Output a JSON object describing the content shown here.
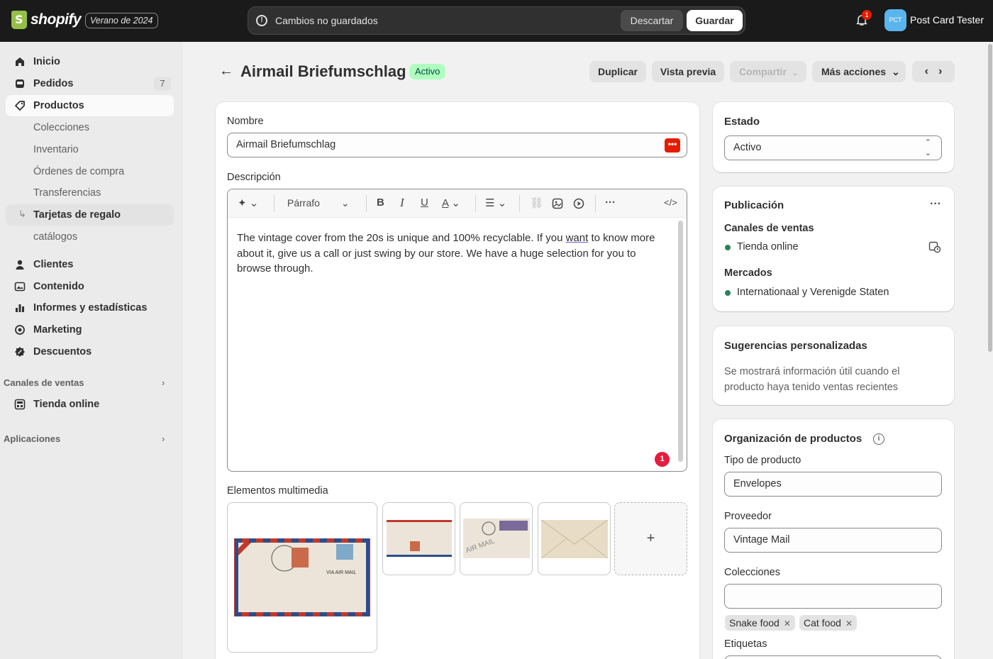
{
  "topbar": {
    "logo_text": "shopify",
    "edition": "Verano de 2024",
    "unsaved_text": "Cambios no guardados",
    "discard_label": "Descartar",
    "save_label": "Guardar",
    "notification_count": "1",
    "avatar_initials": "PCT",
    "store_name": "Post Card Tester"
  },
  "sidebar": {
    "items": [
      {
        "label": "Inicio",
        "icon": "home-icon"
      },
      {
        "label": "Pedidos",
        "icon": "orders-icon",
        "count": "7"
      },
      {
        "label": "Productos",
        "icon": "tag-icon"
      },
      {
        "label": "Colecciones"
      },
      {
        "label": "Inventario"
      },
      {
        "label": "Órdenes de compra"
      },
      {
        "label": "Transferencias"
      },
      {
        "label": "Tarjetas de regalo"
      },
      {
        "label": "catálogos"
      },
      {
        "label": "Clientes",
        "icon": "person-icon"
      },
      {
        "label": "Contenido",
        "icon": "content-icon"
      },
      {
        "label": "Informes y estadísticas",
        "icon": "chart-bar-icon"
      },
      {
        "label": "Marketing",
        "icon": "target-icon"
      },
      {
        "label": "Descuentos",
        "icon": "discount-icon"
      }
    ],
    "sales_channels_heading": "Canales de ventas",
    "online_store": "Tienda online",
    "apps_heading": "Aplicaciones"
  },
  "header": {
    "title": "Airmail Briefumschlag",
    "status": "Activo",
    "duplicate": "Duplicar",
    "preview": "Vista previa",
    "share": "Compartir",
    "more_actions": "Más acciones"
  },
  "product": {
    "name_label": "Nombre",
    "name_value": "Airmail Briefumschlag",
    "description_label": "Descripción",
    "paragraph_select": "Párrafo",
    "description_before": "The vintage cover from the 20s is unique and 100% recyclable. If you ",
    "description_underlined": "want",
    "description_after": " to know more about it, give us a call or just swing by our store. We have a huge selection for you to browse through.",
    "error_count": "1",
    "media_label": "Elementos multimedia",
    "add_media": "+"
  },
  "status_card": {
    "heading": "Estado",
    "value": "Activo"
  },
  "publication": {
    "heading": "Publicación",
    "channels_label": "Canales de ventas",
    "channel": "Tienda online",
    "markets_label": "Mercados",
    "market": "Internationaal y Verenigde Staten"
  },
  "suggestions": {
    "heading": "Sugerencias personalizadas",
    "text": "Se mostrará información útil cuando el producto haya tenido ventas recientes"
  },
  "organization": {
    "heading": "Organización de productos",
    "type_label": "Tipo de producto",
    "type_value": "Envelopes",
    "vendor_label": "Proveedor",
    "vendor_value": "Vintage Mail",
    "collections_label": "Colecciones",
    "collections": [
      "Snake food",
      "Cat food"
    ],
    "tags_label": "Etiquetas"
  },
  "colors": {
    "topbar": "#1a1a1a",
    "active_badge": "#affebf",
    "error": "#e51c3d",
    "channel_dot": "#29845a"
  }
}
